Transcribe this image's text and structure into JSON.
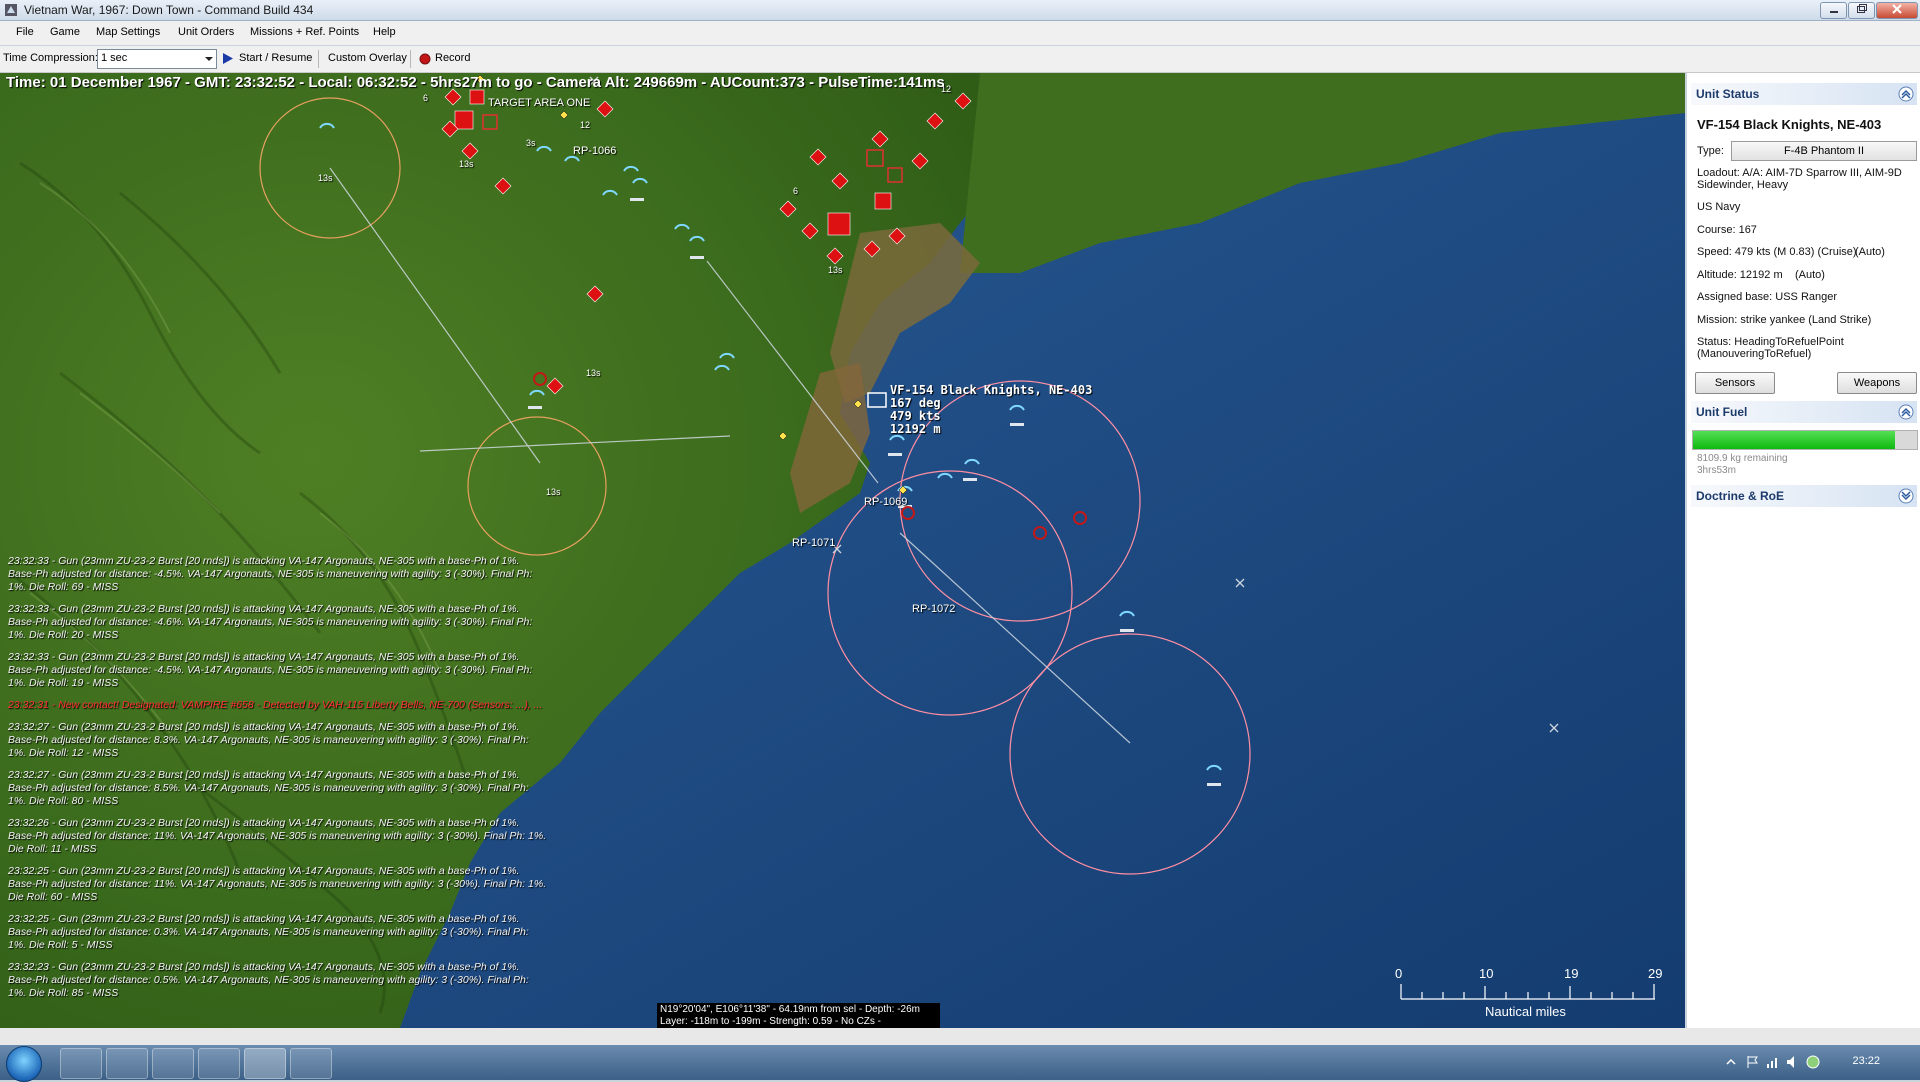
{
  "window": {
    "title": "Vietnam War, 1967: Down Town - Command Build 434"
  },
  "menu": {
    "items": [
      "File",
      "Game",
      "Map Settings",
      "Unit Orders",
      "Missions + Ref. Points",
      "Help"
    ]
  },
  "toolbar": {
    "time_compression_label": "Time Compression:",
    "time_compression_value": "1 sec",
    "start_resume": "Start / Resume",
    "custom_overlay": "Custom Overlay",
    "record": "Record"
  },
  "map": {
    "status_line": "Time: 01 December 1967 - GMT: 23:32:52 - Local: 06:32:52 - 5hrs27m to go - Camera Alt: 249669m - AUCount:373 - PulseTime:141ms",
    "target_label": "TARGET AREA ONE",
    "ref_points": [
      "RP-1066",
      "RP-1071",
      "RP-1072",
      "RP-1069"
    ],
    "selected_unit_label": {
      "name": "VF-154 Black Knights, NE-403",
      "course": "167 deg",
      "speed": "479 kts",
      "altitude": "12192 m"
    },
    "small_labels": [
      "13s",
      "13s",
      "13s",
      "13s",
      "13s",
      "3s",
      "12",
      "6",
      "12",
      "6"
    ],
    "cursor_info": {
      "line1": "N19°20'04\", E106°11'38\" - 64.19nm from sel - Depth: -26m",
      "line2": "Layer: -118m to -199m - Strength: 0.59 - No CZs -"
    },
    "scale": {
      "ticks": [
        "0",
        "10",
        "19",
        "29"
      ],
      "units": "Nautical miles"
    }
  },
  "log": [
    {
      "time": "23:32:33",
      "text": "23:32:33 - Gun (23mm ZU-23-2 Burst [20 rnds]) is attacking VA-147 Argonauts, NE-305 with a base-Ph of 1%. Base-Ph adjusted for distance: -4.5%. VA-147 Argonauts, NE-305 is maneuvering with agility: 3 (-30%). Final Ph: 1%. Die Roll: 69 - MISS",
      "alert": false
    },
    {
      "time": "23:32:33",
      "text": "23:32:33 - Gun (23mm ZU-23-2 Burst [20 rnds]) is attacking VA-147 Argonauts, NE-305 with a base-Ph of 1%. Base-Ph adjusted for distance: -4.6%. VA-147 Argonauts, NE-305 is maneuvering with agility: 3 (-30%). Final Ph: 1%. Die Roll: 20 - MISS",
      "alert": false
    },
    {
      "time": "23:32:33",
      "text": "23:32:33 - Gun (23mm ZU-23-2 Burst [20 rnds]) is attacking VA-147 Argonauts, NE-305 with a base-Ph of 1%. Base-Ph adjusted for distance: -4.5%. VA-147 Argonauts, NE-305 is maneuvering with agility: 3 (-30%). Final Ph: 1%. Die Roll: 19 - MISS",
      "alert": false
    },
    {
      "time": "23:32:31",
      "text": "23:32:31 - New contact! Designated: VAMPIRE #658 - Detected by VAH-115 Liberty Bells, NE-700 (Sensors: ...), ...",
      "alert": true
    },
    {
      "time": "23:32:27",
      "text": "23:32:27 - Gun (23mm ZU-23-2 Burst [20 rnds]) is attacking VA-147 Argonauts, NE-305 with a base-Ph of 1%. Base-Ph adjusted for distance: 8.3%. VA-147 Argonauts, NE-305 is maneuvering with agility: 3 (-30%). Final Ph: 1%. Die Roll: 12 - MISS",
      "alert": false
    },
    {
      "time": "23:32:27",
      "text": "23:32:27 - Gun (23mm ZU-23-2 Burst [20 rnds]) is attacking VA-147 Argonauts, NE-305 with a base-Ph of 1%. Base-Ph adjusted for distance: 8.5%. VA-147 Argonauts, NE-305 is maneuvering with agility: 3 (-30%). Final Ph: 1%. Die Roll: 80 - MISS",
      "alert": false
    },
    {
      "time": "23:32:26",
      "text": "23:32:26 - Gun (23mm ZU-23-2 Burst [20 rnds]) is attacking VA-147 Argonauts, NE-305 with a base-Ph of 1%. Base-Ph adjusted for distance: 11%. VA-147 Argonauts, NE-305 is maneuvering with agility: 3 (-30%). Final Ph: 1%. Die Roll: 11 - MISS",
      "alert": false
    },
    {
      "time": "23:32:25",
      "text": "23:32:25 - Gun (23mm ZU-23-2 Burst [20 rnds]) is attacking VA-147 Argonauts, NE-305 with a base-Ph of 1%. Base-Ph adjusted for distance: 11%. VA-147 Argonauts, NE-305 is maneuvering with agility: 3 (-30%). Final Ph: 1%. Die Roll: 60 - MISS",
      "alert": false
    },
    {
      "time": "23:32:25",
      "text": "23:32:25 - Gun (23mm ZU-23-2 Burst [20 rnds]) is attacking VA-147 Argonauts, NE-305 with a base-Ph of 1%. Base-Ph adjusted for distance: 0.3%. VA-147 Argonauts, NE-305 is maneuvering with agility: 3 (-30%). Final Ph: 1%. Die Roll: 5 - MISS",
      "alert": false
    },
    {
      "time": "23:32:23",
      "text": "23:32:23 - Gun (23mm ZU-23-2 Burst [20 rnds]) is attacking VA-147 Argonauts, NE-305 with a base-Ph of 1%. Base-Ph adjusted for distance: 0.5%. VA-147 Argonauts, NE-305 is maneuvering with agility: 3 (-30%). Final Ph: 1%. Die Roll: 85 - MISS",
      "alert": false
    }
  ],
  "panel": {
    "unit_status_header": "Unit Status",
    "unit_name": "VF-154 Black Knights, NE-403",
    "type_label": "Type:",
    "type_value": "F-4B Phantom II",
    "loadout": "Loadout: A/A: AIM-7D Sparrow III, AIM-9D Sidewinder, Heavy",
    "side": "US Navy",
    "course": "Course: 167",
    "speed": "Speed: 479 kts (M 0.83) (Cruise)",
    "speed_mode": "(Auto)",
    "altitude": "Altitude: 12192 m",
    "altitude_mode": "(Auto)",
    "assigned_base": "Assigned base: USS Ranger",
    "mission": "Mission: strike yankee (Land Strike)",
    "status_line1": "Status: HeadingToRefuelPoint",
    "status_line2": "(ManouveringToRefuel)",
    "sensors_btn": "Sensors",
    "weapons_btn": "Weapons",
    "fuel_header": "Unit Fuel",
    "fuel_fraction": 0.9,
    "fuel_remaining": "8109.9 kg remaining",
    "fuel_time": "3hrs53m",
    "doctrine_header": "Doctrine & RoE"
  },
  "taskbar": {
    "clock": "23:22"
  },
  "colors": {
    "land": "#3e6d1c",
    "sea": "#1c4a82",
    "hostile": "#d11",
    "friendly": "#7fd8ff",
    "accent": "#1c3a6b"
  }
}
